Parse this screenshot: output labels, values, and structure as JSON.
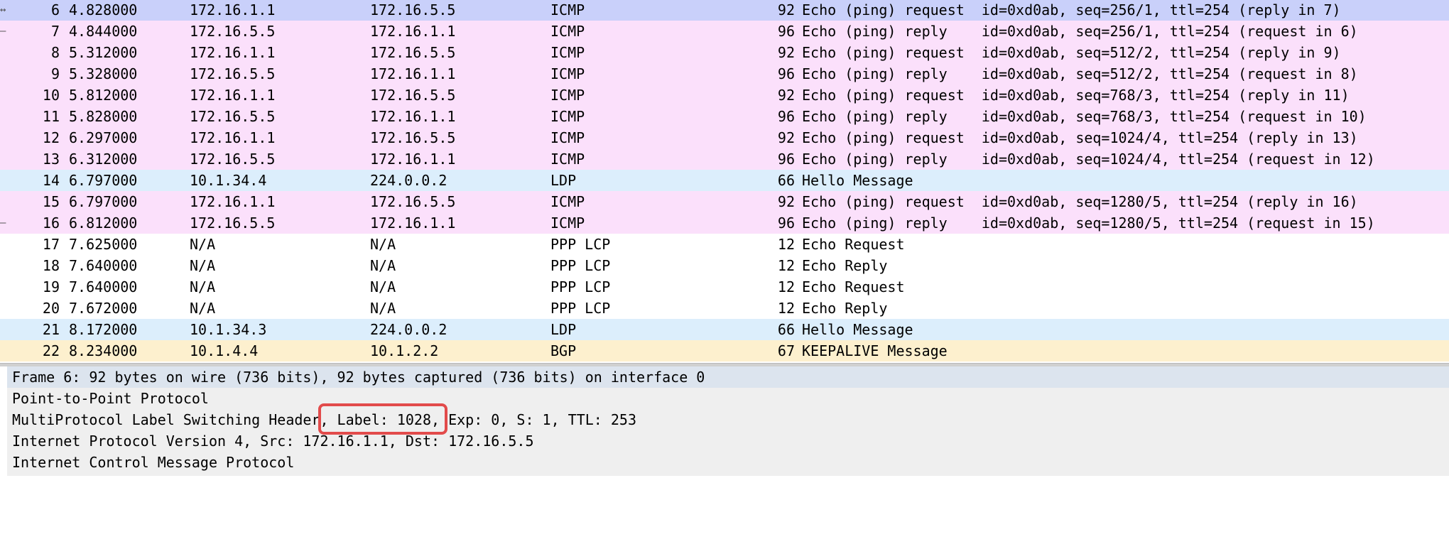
{
  "colors": {
    "selected": "#c9d0fa",
    "icmp": "#fbe0fb",
    "ldp": "#dceefc",
    "ppp": "#ffffff",
    "bgp": "#fdf0ce",
    "details_bg": "#efefef",
    "details_selected": "#dce4ee",
    "highlight": "#e24b4b"
  },
  "packets": [
    {
      "no": "6",
      "time": "4.828000",
      "src": "172.16.1.1",
      "dst": "172.16.5.5",
      "proto": "ICMP",
      "len": "92",
      "info": "Echo (ping) request  id=0xd0ab, seq=256/1, ttl=254 (reply in 7)",
      "color": "selected",
      "marker": "↔"
    },
    {
      "no": "7",
      "time": "4.844000",
      "src": "172.16.5.5",
      "dst": "172.16.1.1",
      "proto": "ICMP",
      "len": "96",
      "info": "Echo (ping) reply    id=0xd0ab, seq=256/1, ttl=254 (request in 6)",
      "color": "icmp",
      "marker": "–"
    },
    {
      "no": "8",
      "time": "5.312000",
      "src": "172.16.1.1",
      "dst": "172.16.5.5",
      "proto": "ICMP",
      "len": "92",
      "info": "Echo (ping) request  id=0xd0ab, seq=512/2, ttl=254 (reply in 9)",
      "color": "icmp",
      "marker": ""
    },
    {
      "no": "9",
      "time": "5.328000",
      "src": "172.16.5.5",
      "dst": "172.16.1.1",
      "proto": "ICMP",
      "len": "96",
      "info": "Echo (ping) reply    id=0xd0ab, seq=512/2, ttl=254 (request in 8)",
      "color": "icmp",
      "marker": ""
    },
    {
      "no": "10",
      "time": "5.812000",
      "src": "172.16.1.1",
      "dst": "172.16.5.5",
      "proto": "ICMP",
      "len": "92",
      "info": "Echo (ping) request  id=0xd0ab, seq=768/3, ttl=254 (reply in 11)",
      "color": "icmp",
      "marker": ""
    },
    {
      "no": "11",
      "time": "5.828000",
      "src": "172.16.5.5",
      "dst": "172.16.1.1",
      "proto": "ICMP",
      "len": "96",
      "info": "Echo (ping) reply    id=0xd0ab, seq=768/3, ttl=254 (request in 10)",
      "color": "icmp",
      "marker": ""
    },
    {
      "no": "12",
      "time": "6.297000",
      "src": "172.16.1.1",
      "dst": "172.16.5.5",
      "proto": "ICMP",
      "len": "92",
      "info": "Echo (ping) request  id=0xd0ab, seq=1024/4, ttl=254 (reply in 13)",
      "color": "icmp",
      "marker": ""
    },
    {
      "no": "13",
      "time": "6.312000",
      "src": "172.16.5.5",
      "dst": "172.16.1.1",
      "proto": "ICMP",
      "len": "96",
      "info": "Echo (ping) reply    id=0xd0ab, seq=1024/4, ttl=254 (request in 12)",
      "color": "icmp",
      "marker": ""
    },
    {
      "no": "14",
      "time": "6.797000",
      "src": "10.1.34.4",
      "dst": "224.0.0.2",
      "proto": "LDP",
      "len": "66",
      "info": "Hello Message",
      "color": "ldp",
      "marker": ""
    },
    {
      "no": "15",
      "time": "6.797000",
      "src": "172.16.1.1",
      "dst": "172.16.5.5",
      "proto": "ICMP",
      "len": "92",
      "info": "Echo (ping) request  id=0xd0ab, seq=1280/5, ttl=254 (reply in 16)",
      "color": "icmp",
      "marker": ""
    },
    {
      "no": "16",
      "time": "6.812000",
      "src": "172.16.5.5",
      "dst": "172.16.1.1",
      "proto": "ICMP",
      "len": "96",
      "info": "Echo (ping) reply    id=0xd0ab, seq=1280/5, ttl=254 (request in 15)",
      "color": "icmp",
      "marker": "–"
    },
    {
      "no": "17",
      "time": "7.625000",
      "src": "N/A",
      "dst": "N/A",
      "proto": "PPP LCP",
      "len": "12",
      "info": "Echo Request",
      "color": "ppp",
      "marker": ""
    },
    {
      "no": "18",
      "time": "7.640000",
      "src": "N/A",
      "dst": "N/A",
      "proto": "PPP LCP",
      "len": "12",
      "info": "Echo Reply",
      "color": "ppp",
      "marker": ""
    },
    {
      "no": "19",
      "time": "7.640000",
      "src": "N/A",
      "dst": "N/A",
      "proto": "PPP LCP",
      "len": "12",
      "info": "Echo Request",
      "color": "ppp",
      "marker": ""
    },
    {
      "no": "20",
      "time": "7.672000",
      "src": "N/A",
      "dst": "N/A",
      "proto": "PPP LCP",
      "len": "12",
      "info": "Echo Reply",
      "color": "ppp",
      "marker": ""
    },
    {
      "no": "21",
      "time": "8.172000",
      "src": "10.1.34.3",
      "dst": "224.0.0.2",
      "proto": "LDP",
      "len": "66",
      "info": "Hello Message",
      "color": "ldp",
      "marker": ""
    },
    {
      "no": "22",
      "time": "8.234000",
      "src": "10.1.4.4",
      "dst": "10.1.2.2",
      "proto": "BGP",
      "len": "67",
      "info": "KEEPALIVE Message",
      "color": "bgp",
      "marker": ""
    }
  ],
  "details": [
    {
      "text": "Frame 6: 92 bytes on wire (736 bits), 92 bytes captured (736 bits) on interface 0",
      "selected": true
    },
    {
      "text": "Point-to-Point Protocol",
      "selected": false
    },
    {
      "text": "MultiProtocol Label Switching Header, Label: 1028, Exp: 0, S: 1, TTL: 253",
      "selected": false
    },
    {
      "text": "Internet Protocol Version 4, Src: 172.16.1.1, Dst: 172.16.5.5",
      "selected": false
    },
    {
      "text": "Internet Control Message Protocol",
      "selected": false
    }
  ]
}
